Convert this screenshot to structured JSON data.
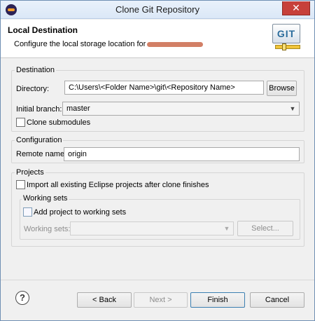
{
  "window": {
    "title": "Clone Git Repository",
    "close_glyph": "✕"
  },
  "banner": {
    "title": "Local Destination",
    "description": "Configure the local storage location for",
    "logo_text": "GIT"
  },
  "destination": {
    "group_label": "Destination",
    "directory_label": "Directory:",
    "directory_value": "C:\\Users\\<Folder Name>\\git\\<Repository Name>",
    "browse_label": "Browse",
    "branch_label": "Initial branch:",
    "branch_value": "master",
    "clone_submodules_label": "Clone submodules",
    "clone_submodules_checked": false
  },
  "configuration": {
    "group_label": "Configuration",
    "remote_label": "Remote name:",
    "remote_value": "origin"
  },
  "projects": {
    "group_label": "Projects",
    "import_label": "Import all existing Eclipse projects after clone finishes",
    "import_checked": false,
    "working_sets": {
      "group_label": "Working sets",
      "add_label": "Add project to working sets",
      "add_checked": false,
      "sets_label": "Working sets:",
      "sets_value": "",
      "select_label": "Select..."
    }
  },
  "footer": {
    "help_glyph": "?",
    "back_label": "< Back",
    "next_label": "Next >",
    "finish_label": "Finish",
    "cancel_label": "Cancel"
  },
  "colors": {
    "window_border": "#6f8fb3",
    "close_button": "#c7403a",
    "primary_button_border": "#3c7fb1"
  }
}
